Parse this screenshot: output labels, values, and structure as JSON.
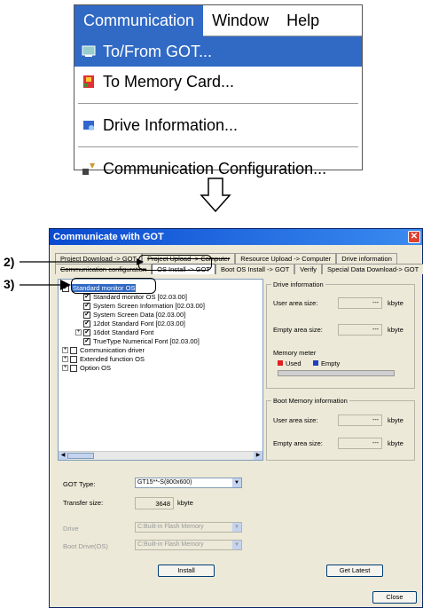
{
  "menu": {
    "bar": [
      {
        "label": "Communication",
        "active": true
      },
      {
        "label": "Window",
        "active": false
      },
      {
        "label": "Help",
        "active": false
      }
    ],
    "items": [
      {
        "label": "To/From GOT...",
        "icon": "transfer-icon",
        "selected": true
      },
      {
        "label": "To Memory Card...",
        "icon": "memory-card-icon",
        "selected": false
      },
      {
        "label": "Drive Information...",
        "icon": "drive-info-icon",
        "selected": false
      },
      {
        "label": "Communication Configuration...",
        "icon": "comm-config-icon",
        "selected": false
      }
    ]
  },
  "dialog": {
    "title": "Communicate with GOT",
    "tabs_row1": [
      "Project Download -> GOT",
      "Project Upload -> Computer",
      "Resource Upload -> Computer",
      "Drive information"
    ],
    "tabs_row2": [
      "Communication configuration",
      "OS Install -> GOT",
      "Boot OS Install -> GOT",
      "Verify",
      "Special Data Download-> GOT"
    ],
    "tree": {
      "root": "Standard monitor OS",
      "children": [
        "Standard monitor OS [02.03.00]",
        "System Screen Information [02.03.00]",
        "System Screen Data [02.03.00]",
        "12dot Standard Font [02.03.00]",
        "16dot Standard Font",
        "TrueType Numerical Font [02.03.00]"
      ],
      "others": [
        "Communication driver",
        "Extended function OS",
        "Option OS"
      ]
    },
    "drive_info": {
      "title": "Drive information",
      "user_area_label": "User area size:",
      "user_area_value": "---",
      "empty_area_label": "Empty area size:",
      "empty_area_value": "---",
      "unit": "kbyte",
      "meter_label": "Memory meter",
      "used_label": "Used",
      "empty_label": "Empty"
    },
    "boot_info": {
      "title": "Boot Memory information",
      "user_area_label": "User area size:",
      "user_area_value": "---",
      "empty_area_label": "Empty area size:",
      "empty_area_value": "---",
      "unit": "kbyte"
    },
    "got_type_label": "GOT Type:",
    "got_type_value": "GT15**-S(800x600)",
    "transfer_size_label": "Transfer size:",
    "transfer_size_value": "3648",
    "transfer_size_unit": "kbyte",
    "drive_label": "Drive",
    "drive_value": "C:Built-in Flash Memory",
    "boot_drive_label": "Boot Drive(OS)",
    "boot_drive_value": "C:Built-in Flash Memory",
    "install_button": "Install",
    "get_latest_button": "Get Latest",
    "close_button": "Close",
    "colors": {
      "used": "#e02020",
      "empty": "#2040c0"
    }
  },
  "callouts": {
    "c2": "2)",
    "c3": "3)"
  }
}
